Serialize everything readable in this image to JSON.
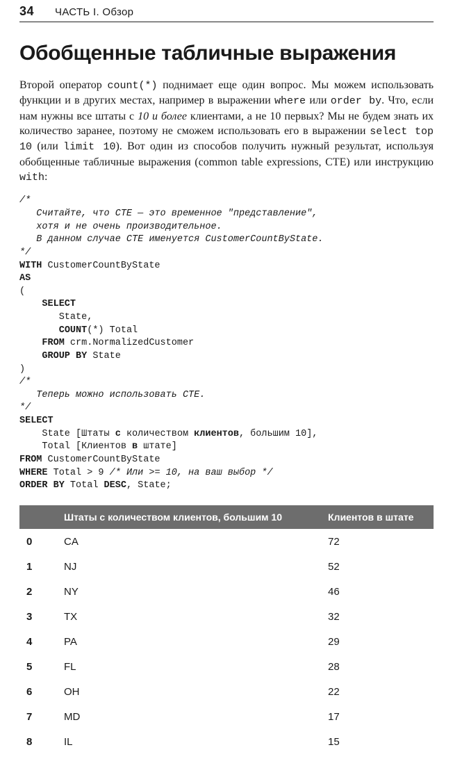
{
  "header": {
    "page_number": "34",
    "section": "ЧАСТЬ I. Обзор"
  },
  "title": "Обобщенные табличные выражения",
  "paragraph": {
    "p1": "Второй оператор ",
    "c1": "count(*)",
    "p2": " поднимает еще один вопрос. Мы можем использовать функции и в других местах, например в выражении ",
    "c2": "where",
    "p3": " или ",
    "c3": "order by",
    "p4": ". Что, если нам нужны все штаты с ",
    "i1": "10 и более",
    "p5": " клиентами, а не 10 первых? Мы не будем знать их количество заранее, поэтому не сможем использовать его в выражении ",
    "c4": "select top 10",
    "p6": " (или ",
    "c5": "limit 10",
    "p7": "). Вот один из способов получить нужный результат, используя обобщенные табличные выражения (common table expressions, CTE) или инструкцию ",
    "c6": "with",
    "p8": ":"
  },
  "code": {
    "l01": "/*",
    "l02": "   Считайте, что CTE — это временное \"представление\",",
    "l03": "   хотя и не очень производительное.",
    "l04": "   В данном случае CTE именуется CustomerCountByState.",
    "l05": "*/",
    "l06a": "WITH",
    "l06b": " CustomerCountByState",
    "l07": "AS",
    "l08": "(",
    "l09": "    SELECT",
    "l10": "       State,",
    "l11a": "       ",
    "l11b": "COUNT",
    "l11c": "(*) Total",
    "l12a": "    FROM",
    "l12b": " crm.NormalizedCustomer",
    "l13a": "    GROUP BY",
    "l13b": " State",
    "l14": ")",
    "l15": "/*",
    "l16": "   Теперь можно использовать CTE.",
    "l17": "*/",
    "l18": "SELECT",
    "l19a": "    State [Штаты ",
    "l19b": "с",
    "l19c": " количеством ",
    "l19d": "клиентов",
    "l19e": ", большим 10],",
    "l20a": "    Total [Клиентов ",
    "l20b": "в",
    "l20c": " штате]",
    "l21a": "FROM",
    "l21b": " CustomerCountByState",
    "l22a": "WHERE",
    "l22b": " Total > 9 ",
    "l22c": "/* Или >= 10, на ваш выбор */",
    "l23a": "ORDER BY",
    "l23b": " Total ",
    "l23c": "DESC",
    "l23d": ", State;"
  },
  "table": {
    "headers": {
      "idx": "",
      "col1": "Штаты с количеством клиентов, большим 10",
      "col2": "Клиентов в штате"
    },
    "rows": [
      {
        "idx": "0",
        "state": "CA",
        "count": "72"
      },
      {
        "idx": "1",
        "state": "NJ",
        "count": "52"
      },
      {
        "idx": "2",
        "state": "NY",
        "count": "46"
      },
      {
        "idx": "3",
        "state": "TX",
        "count": "32"
      },
      {
        "idx": "4",
        "state": "PA",
        "count": "29"
      },
      {
        "idx": "5",
        "state": "FL",
        "count": "28"
      },
      {
        "idx": "6",
        "state": "OH",
        "count": "22"
      },
      {
        "idx": "7",
        "state": "MD",
        "count": "17"
      },
      {
        "idx": "8",
        "state": "IL",
        "count": "15"
      }
    ]
  }
}
